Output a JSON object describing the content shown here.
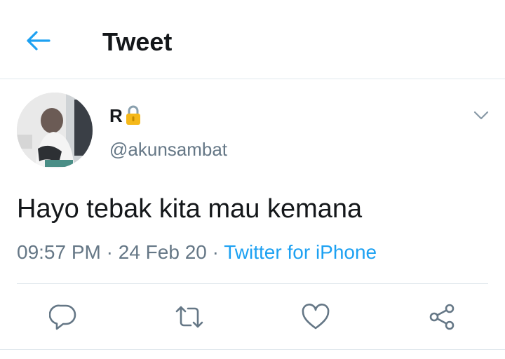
{
  "header": {
    "title": "Tweet",
    "back_icon": "back-arrow-icon",
    "accent_color": "#1da1f2"
  },
  "tweet": {
    "display_name": "R",
    "protected_icon": "lock-icon",
    "username": "@akunsambat",
    "text": "Hayo tebak kita mau kemana",
    "time": "09:57 PM",
    "separator": " · ",
    "date": "24 Feb 20",
    "source": "Twitter for iPhone",
    "menu_icon": "chevron-down-icon"
  },
  "actions": [
    {
      "name": "reply",
      "icon": "reply-icon"
    },
    {
      "name": "retweet",
      "icon": "retweet-icon"
    },
    {
      "name": "like",
      "icon": "heart-icon"
    },
    {
      "name": "share",
      "icon": "share-icon"
    }
  ],
  "colors": {
    "text_primary": "#14171a",
    "text_secondary": "#657786",
    "divider": "#e1e8ed",
    "link": "#1da1f2",
    "icon_gray": "#657786"
  }
}
